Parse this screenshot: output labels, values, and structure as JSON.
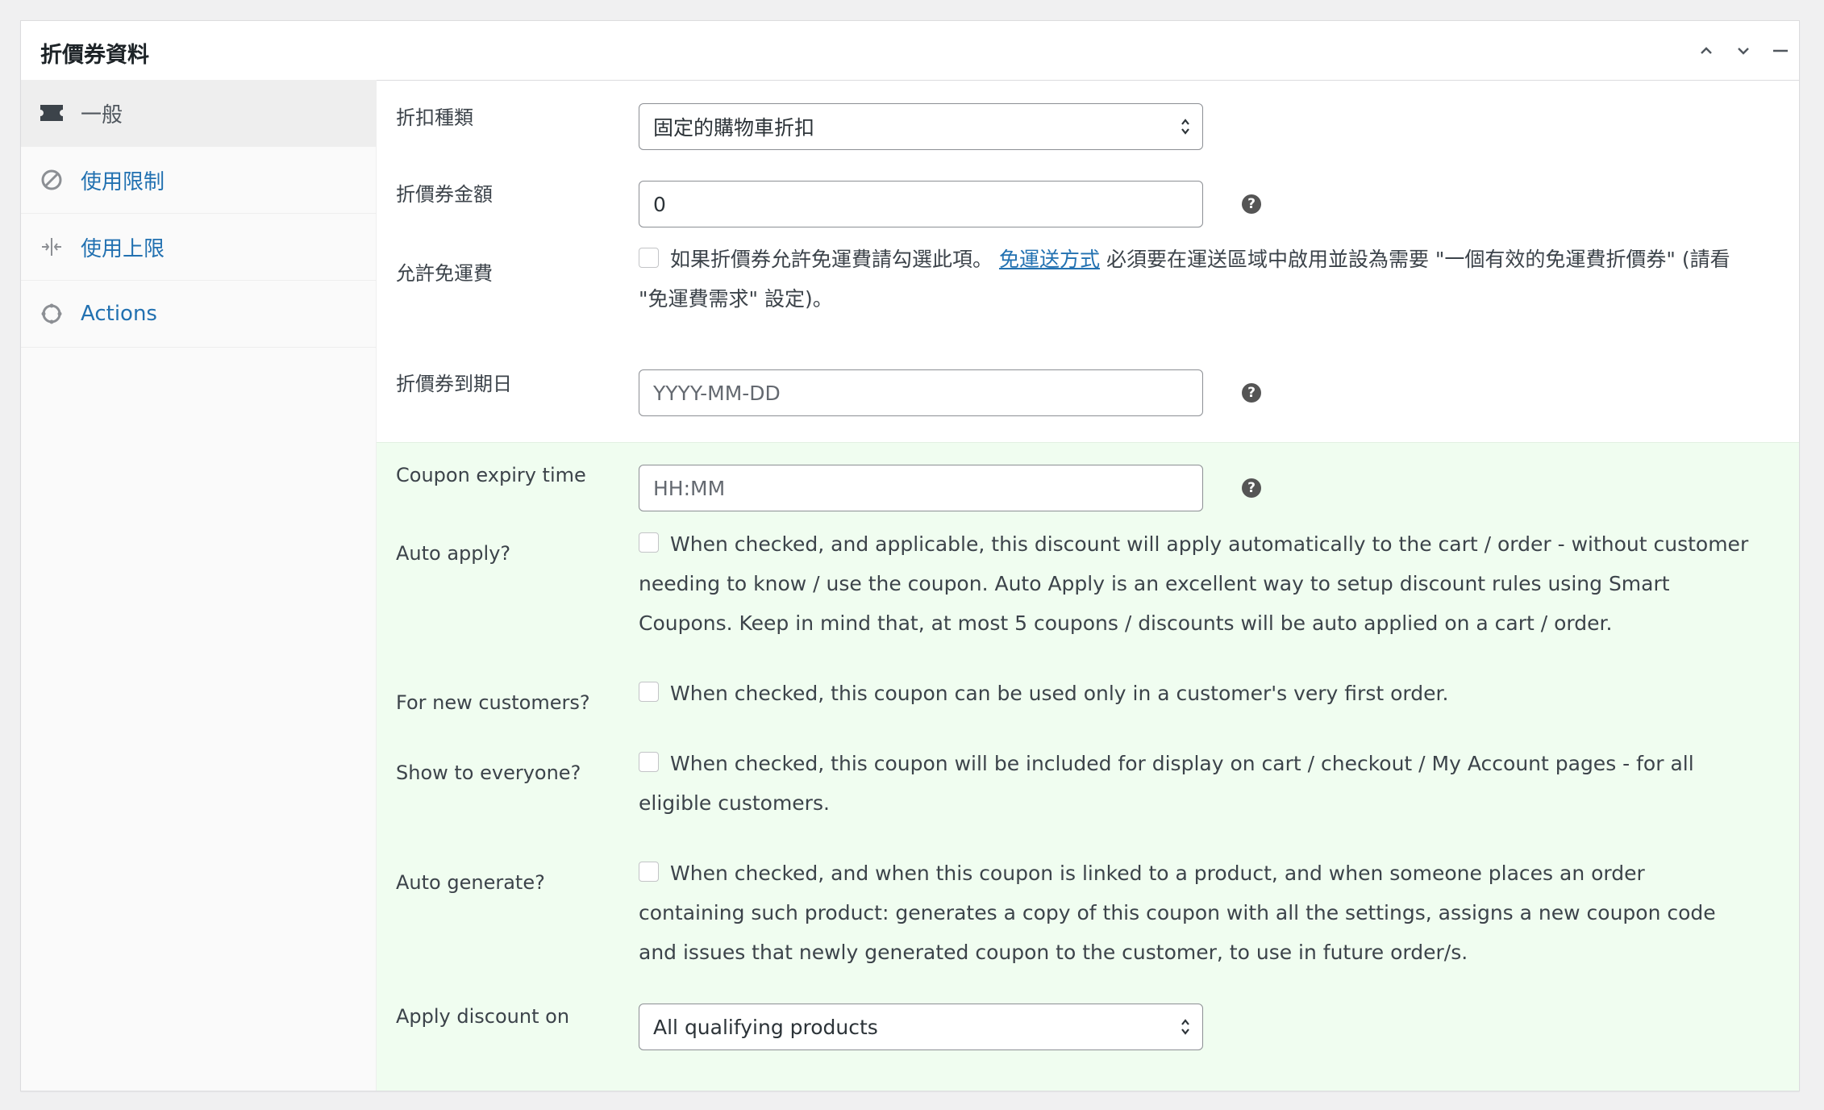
{
  "panel": {
    "title": "折價券資料"
  },
  "header_icons": [
    "chevron-up-icon",
    "chevron-down-icon",
    "collapse-icon"
  ],
  "tabs": [
    {
      "label": "一般",
      "icon": "ticket-icon",
      "active": true
    },
    {
      "label": "使用限制",
      "icon": "block-icon",
      "active": false
    },
    {
      "label": "使用上限",
      "icon": "limit-icon",
      "active": false
    },
    {
      "label": "Actions",
      "icon": "circle-icon",
      "active": false
    }
  ],
  "fields": {
    "discount_type": {
      "label": "折扣種類",
      "value": "固定的購物車折扣"
    },
    "coupon_amount": {
      "label": "折價券金額",
      "value": "0"
    },
    "free_shipping": {
      "label": "允許免運費",
      "text_before": "如果折價券允許免運費請勾選此項。",
      "link": "免運送方式",
      "text_after": "必須要在運送區域中啟用並設為需要 \"一個有效的免運費折價券\" (請看 \"免運費需求\" 設定)。"
    },
    "expiry_date": {
      "label": "折價券到期日",
      "placeholder": "YYYY-MM-DD"
    },
    "expiry_time": {
      "label": "Coupon expiry time",
      "placeholder": "HH:MM"
    },
    "auto_apply": {
      "label": "Auto apply?",
      "description": "When checked, and applicable, this discount will apply automatically to the cart / order - without customer needing to know / use the coupon. Auto Apply is an excellent way to setup discount rules using Smart Coupons. Keep in mind that, at most 5 coupons / discounts will be auto applied on a cart / order."
    },
    "new_customers": {
      "label": "For new customers?",
      "description": "When checked, this coupon can be used only in a customer's very first order."
    },
    "show_everyone": {
      "label": "Show to everyone?",
      "description": "When checked, this coupon will be included for display on cart / checkout / My Account pages - for all eligible customers."
    },
    "auto_generate": {
      "label": "Auto generate?",
      "description": "When checked, and when this coupon is linked to a product, and when someone places an order containing such product: generates a copy of this coupon with all the settings, assigns a new coupon code and issues that newly generated coupon to the customer, to use in future order/s."
    },
    "apply_on": {
      "label": "Apply discount on",
      "value": "All qualifying products"
    }
  },
  "colors": {
    "green_bg": "#f0fdf0",
    "link": "#2271b1",
    "help": "#555555"
  }
}
